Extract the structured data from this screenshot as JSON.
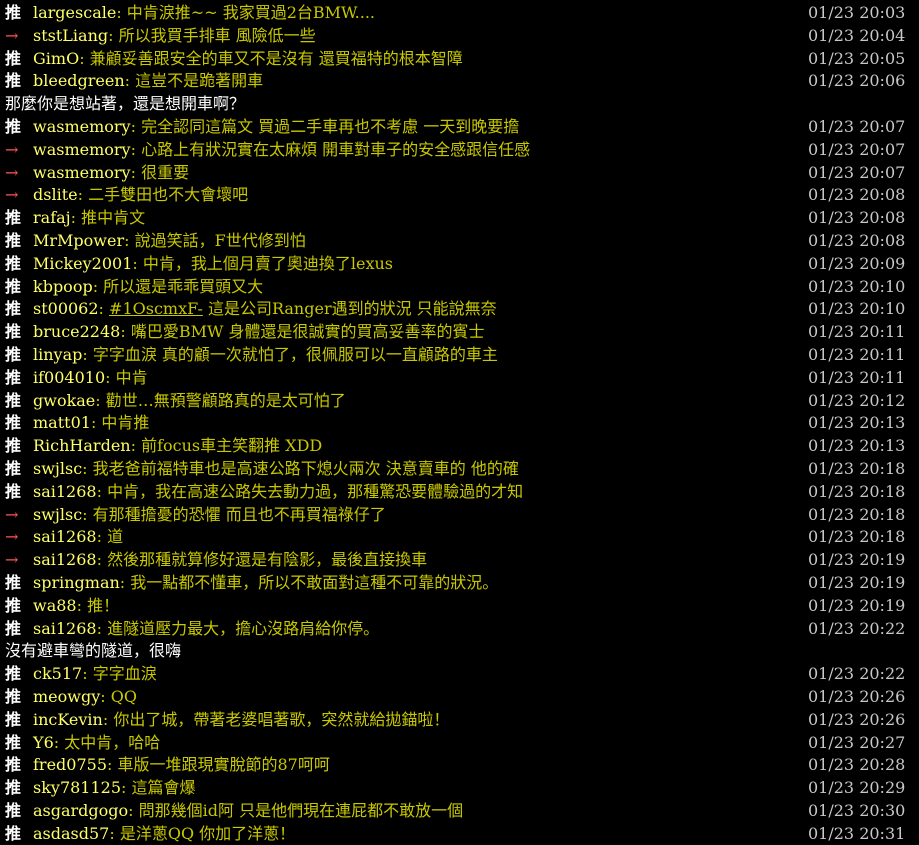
{
  "comments": [
    {
      "type": "push",
      "tag": "推",
      "user": "largescale",
      "text": "中肯淚推~~ 我家買過2台BMW....",
      "time": "01/23 20:03"
    },
    {
      "type": "arrow",
      "tag": "→",
      "user": "ststLiang",
      "text": "所以我買手排車  風險低一些",
      "time": "01/23 20:04"
    },
    {
      "type": "push",
      "tag": "推",
      "user": "GimO",
      "text": "兼顧妥善跟安全的車又不是沒有 還買福特的根本智障",
      "time": "01/23 20:05"
    },
    {
      "type": "push",
      "tag": "推",
      "user": "bleedgreen",
      "text": "這豈不是跪著開車",
      "time": "01/23 20:06"
    },
    {
      "type": "cont",
      "text": "那麼你是想站著，還是想開車啊？"
    },
    {
      "type": "push",
      "tag": "推",
      "user": "wasmemory",
      "text": "完全認同這篇文 買過二手車再也不考慮  一天到晚要擔",
      "time": "01/23 20:07"
    },
    {
      "type": "arrow",
      "tag": "→",
      "user": "wasmemory",
      "text": "心路上有狀況實在太麻煩  開車對車子的安全感跟信任感",
      "time": "01/23 20:07"
    },
    {
      "type": "arrow",
      "tag": "→",
      "user": "wasmemory",
      "text": "很重要",
      "time": "01/23 20:07"
    },
    {
      "type": "arrow",
      "tag": "→",
      "user": "dslite",
      "text": "二手雙田也不大會壞吧",
      "time": "01/23 20:08"
    },
    {
      "type": "push",
      "tag": "推",
      "user": "rafaj",
      "text": "推中肯文",
      "time": "01/23 20:08"
    },
    {
      "type": "push",
      "tag": "推",
      "user": "MrMpower",
      "text": "說過笑話，F世代修到怕",
      "time": "01/23 20:08"
    },
    {
      "type": "push",
      "tag": "推",
      "user": "Mickey2001",
      "text": "中肯，我上個月賣了奧迪換了lexus",
      "time": "01/23 20:09"
    },
    {
      "type": "push",
      "tag": "推",
      "user": "kbpoop",
      "text": "所以還是乖乖買頭又大",
      "time": "01/23 20:10"
    },
    {
      "type": "push",
      "tag": "推",
      "user": "st00062",
      "link": "#1OscmxF-",
      "text": " 這是公司Ranger遇到的狀況 只能說無奈",
      "time": "01/23 20:10"
    },
    {
      "type": "push",
      "tag": "推",
      "user": "bruce2248",
      "text": "嘴巴愛BMW 身體還是很誠實的買高妥善率的賓士",
      "time": "01/23 20:11"
    },
    {
      "type": "push",
      "tag": "推",
      "user": "linyap",
      "text": "字字血淚 真的顧一次就怕了，很佩服可以一直顧路的車主",
      "time": "01/23 20:11"
    },
    {
      "type": "push",
      "tag": "推",
      "user": "if004010",
      "text": "中肯",
      "time": "01/23 20:11"
    },
    {
      "type": "push",
      "tag": "推",
      "user": "gwokae",
      "text": "勸世…無預警顧路真的是太可怕了",
      "time": "01/23 20:12"
    },
    {
      "type": "push",
      "tag": "推",
      "user": "matt01",
      "text": "中肯推",
      "time": "01/23 20:13"
    },
    {
      "type": "push",
      "tag": "推",
      "user": "RichHarden",
      "text": "前focus車主笑翻推 XDD",
      "time": "01/23 20:13"
    },
    {
      "type": "push",
      "tag": "推",
      "user": "swjlsc",
      "text": "我老爸前福特車也是高速公路下熄火兩次 決意賣車的 他的確",
      "time": "01/23 20:18"
    },
    {
      "type": "push",
      "tag": "推",
      "user": "sai1268",
      "text": "中肯，我在高速公路失去動力過，那種驚恐要體驗過的才知",
      "time": "01/23 20:18"
    },
    {
      "type": "arrow",
      "tag": "→",
      "user": "swjlsc",
      "text": "有那種擔憂的恐懼 而且也不再買福祿仔了",
      "time": "01/23 20:18"
    },
    {
      "type": "arrow",
      "tag": "→",
      "user": "sai1268",
      "text": "道",
      "time": "01/23 20:18"
    },
    {
      "type": "arrow",
      "tag": "→",
      "user": "sai1268",
      "text": "然後那種就算修好還是有陰影，最後直接換車",
      "time": "01/23 20:19"
    },
    {
      "type": "push",
      "tag": "推",
      "user": "springman",
      "text": "我一點都不懂車，所以不敢面對這種不可靠的狀況。",
      "time": "01/23 20:19"
    },
    {
      "type": "push",
      "tag": "推",
      "user": "wa88",
      "text": "推！",
      "time": "01/23 20:19"
    },
    {
      "type": "push",
      "tag": "推",
      "user": "sai1268",
      "text": "進隧道壓力最大，擔心沒路肩給你停。",
      "time": "01/23 20:22"
    },
    {
      "type": "cont",
      "text": "沒有避車彎的隧道，很嗨"
    },
    {
      "type": "push",
      "tag": "推",
      "user": "ck517",
      "text": "字字血淚",
      "time": "01/23 20:22"
    },
    {
      "type": "push",
      "tag": "推",
      "user": "meowgy",
      "text": "QQ",
      "time": "01/23 20:26"
    },
    {
      "type": "push",
      "tag": "推",
      "user": "incKevin",
      "text": "你出了城，帶著老婆唱著歌，突然就給拋錨啦！",
      "time": "01/23 20:26"
    },
    {
      "type": "push",
      "tag": "推",
      "user": "Y6",
      "text": "太中肯，哈哈",
      "time": "01/23 20:27"
    },
    {
      "type": "push",
      "tag": "推",
      "user": "fred0755",
      "text": "車版一堆跟現實脫節的87呵呵",
      "time": "01/23 20:28"
    },
    {
      "type": "push",
      "tag": "推",
      "user": "sky781125",
      "text": "這篇會爆",
      "time": "01/23 20:29"
    },
    {
      "type": "push",
      "tag": "推",
      "user": "asgardgogo",
      "text": "問那幾個id阿 只是他們現在連屁都不敢放一個",
      "time": "01/23 20:30"
    },
    {
      "type": "push",
      "tag": "推",
      "user": "asdasd57",
      "text": "是洋蔥QQ 你加了洋蔥！",
      "time": "01/23 20:31"
    }
  ]
}
